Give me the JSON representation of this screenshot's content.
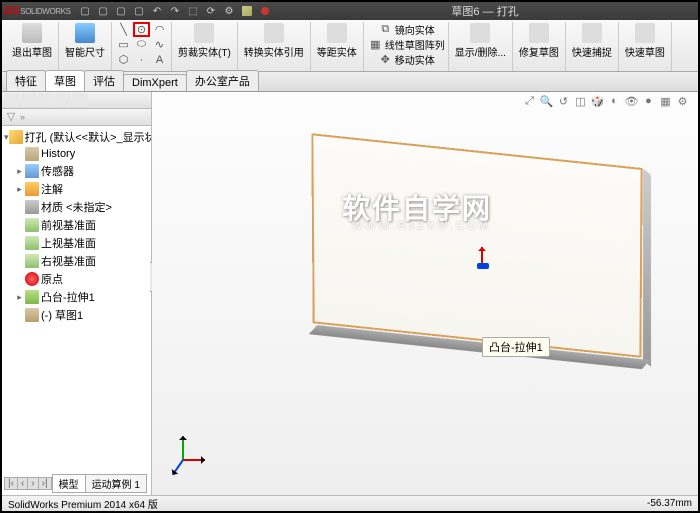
{
  "title": "草图6 — 打孔",
  "qat": [
    "new",
    "open",
    "save",
    "print",
    "undo",
    "redo",
    "select",
    "rebuild",
    "options",
    "cube",
    "red"
  ],
  "ribbon": {
    "exit_sketch": "退出草图",
    "smart_dim": "智能尺寸",
    "trim_label": "剪裁实体(T)",
    "convert_label": "转换实体引用",
    "offset_label": "等距实体",
    "mirror_label": "镜向实体",
    "pattern_label": "线性草图阵列",
    "move_label": "移动实体",
    "display_label": "显示/删除...",
    "repair_label": "修复草图",
    "quick_snap": "快速捕捉",
    "quick_sketch": "快速草图"
  },
  "tabs": [
    "特征",
    "草图",
    "评估",
    "DimXpert",
    "办公室产品"
  ],
  "active_tab": 1,
  "tree": {
    "root": "打孔 (默认<<默认>_显示状态",
    "items": [
      {
        "icon": "hist",
        "label": "History"
      },
      {
        "icon": "sensor",
        "label": "传感器"
      },
      {
        "icon": "annot",
        "label": "注解"
      },
      {
        "icon": "mat",
        "label": "材质 <未指定>"
      },
      {
        "icon": "plane",
        "label": "前视基准面"
      },
      {
        "icon": "plane",
        "label": "上视基准面"
      },
      {
        "icon": "plane",
        "label": "右视基准面"
      },
      {
        "icon": "origin",
        "label": "原点"
      },
      {
        "icon": "ext",
        "label": "凸台-拉伸1"
      },
      {
        "icon": "sketch",
        "label": "(-) 草图1"
      }
    ]
  },
  "tooltip_text": "凸台-拉伸1",
  "bottom_tabs": {
    "model": "模型",
    "motion": "运动算例 1"
  },
  "status_text": "SolidWorks Premium 2014 x64 版",
  "status_coord": "-56.37mm",
  "watermark": "软件自学网",
  "watermark_sub": "WWW.RJZXW.COM"
}
